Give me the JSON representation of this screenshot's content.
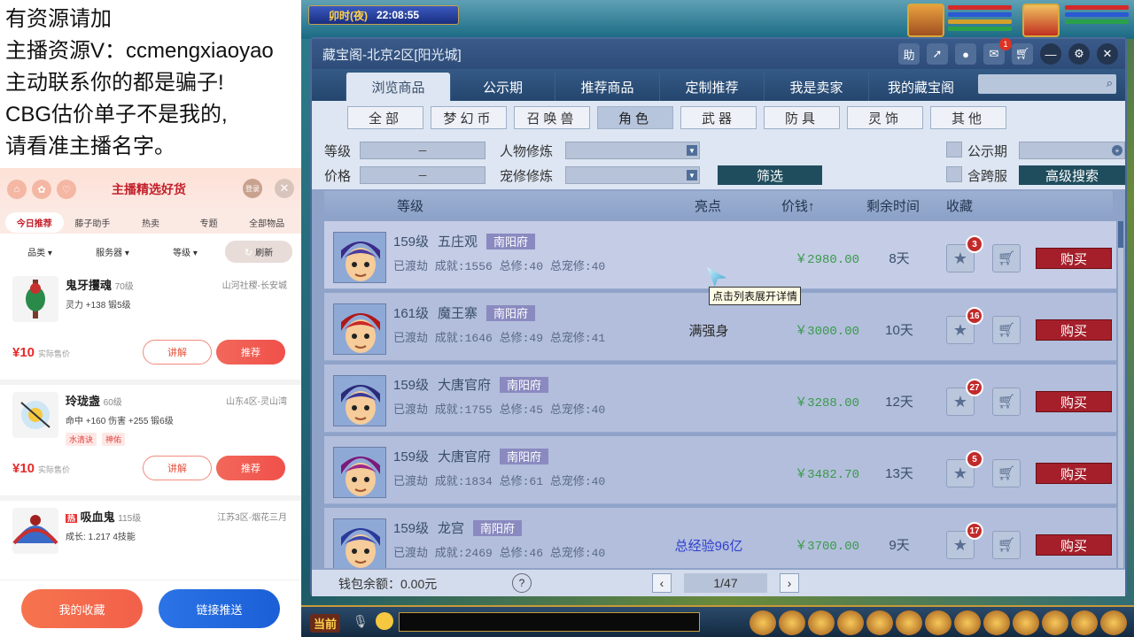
{
  "overlay": {
    "lines": [
      "有资源请加",
      "主播资源V：ccmengxiaoyao",
      "主动联系你的都是骗子!",
      "CBG估价单子不是我的,",
      "请看准主播名字。"
    ]
  },
  "shop": {
    "title": "主播精选好货",
    "login": "登录",
    "tabs": [
      "今日推荐",
      "藤子助手",
      "热卖",
      "专题",
      "全部物品"
    ],
    "filters": [
      "品类 ▾",
      "服务器 ▾",
      "等级 ▾"
    ],
    "refresh": "刷新",
    "items": [
      {
        "name": "鬼牙攫魂",
        "level": "70级",
        "server": "山河社稷-长安城",
        "attr": "灵力 +138 锻5级",
        "tags": [],
        "price": "¥10",
        "price_note": "实际售价",
        "explain": "讲解",
        "recommend": "推荐"
      },
      {
        "name": "玲珑盏",
        "level": "60级",
        "server": "山东4区-灵山湾",
        "attr": "命中 +160 伤害 +255 锻6级",
        "tags": [
          "水清诀",
          "神佑"
        ],
        "price": "¥10",
        "price_note": "实际售价",
        "explain": "讲解",
        "recommend": "推荐"
      },
      {
        "name": "吸血鬼",
        "level": "115级",
        "server": "江苏3区-烟花三月",
        "attr": "成长: 1.217 4技能",
        "tags": [],
        "price": "",
        "price_note": "",
        "explain": "",
        "recommend": ""
      }
    ],
    "fav_button": "我的收藏",
    "push_button": "链接推送"
  },
  "game": {
    "time_label": "卯时(夜)",
    "clock": "22:08:55",
    "window_title": "藏宝阁-北京2区[阳光城]",
    "cart_badge": "1",
    "nav_tabs": [
      "浏览商品",
      "公示期",
      "推荐商品",
      "定制推荐",
      "我是卖家",
      "我的藏宝阁"
    ],
    "categories": [
      "全部",
      "梦幻币",
      "召唤兽",
      "角色",
      "武器",
      "防具",
      "灵饰",
      "其他"
    ],
    "filters": {
      "level": "等级",
      "level_range": "－",
      "price": "价格",
      "price_range": "－",
      "char_cultivation": "人物修炼",
      "pet_cultivation": "宠修修炼",
      "filter_btn": "筛选",
      "public_period": "公示期",
      "cross_server": "含跨服",
      "advanced_search": "高级搜索"
    },
    "table_headers": {
      "level": "等级",
      "highlight": "亮点",
      "price": "价钱↑",
      "remaining": "剩余时间",
      "collect": "收藏"
    },
    "rows": [
      {
        "level": "159级",
        "school": "五庄观",
        "server": "南阳府",
        "stats": "已渡劫 成就:1556 总修:40 总宠修:40",
        "highlight": "",
        "price": "￥2980.00",
        "time": "8天",
        "fav": "3",
        "buy": "购买",
        "face": "#4a3aa0",
        "hair": "#3a2a8a"
      },
      {
        "level": "161级",
        "school": "魔王寨",
        "server": "南阳府",
        "stats": "已渡劫 成就:1646 总修:49 总宠修:41",
        "highlight": "满强身",
        "price": "￥3000.00",
        "time": "10天",
        "fav": "16",
        "buy": "购买",
        "face": "#c82a2a",
        "hair": "#b01818"
      },
      {
        "level": "159级",
        "school": "大唐官府",
        "server": "南阳府",
        "stats": "已渡劫 成就:1755 总修:45 总宠修:40",
        "highlight": "",
        "price": "￥3288.00",
        "time": "12天",
        "fav": "27",
        "buy": "购买",
        "face": "#3a3a9a",
        "hair": "#2a2a7a"
      },
      {
        "level": "159级",
        "school": "大唐官府",
        "server": "南阳府",
        "stats": "已渡劫 成就:1834 总修:61 总宠修:40",
        "highlight": "",
        "price": "￥3482.70",
        "time": "13天",
        "fav": "5",
        "buy": "购买",
        "face": "#9a2a8a",
        "hair": "#7a1a7a"
      },
      {
        "level": "159级",
        "school": "龙宫",
        "server": "南阳府",
        "stats": "已渡劫 成就:2469 总修:46 总宠修:40",
        "highlight": "总经验96亿",
        "price": "￥3700.00",
        "time": "9天",
        "fav": "17",
        "buy": "购买",
        "face": "#3a4ab0",
        "hair": "#2a3a9a"
      }
    ],
    "tooltip": "点击列表展开详情",
    "wallet": "钱包余额：0.00元",
    "help": "?",
    "page": "1/47",
    "current": "当前"
  }
}
